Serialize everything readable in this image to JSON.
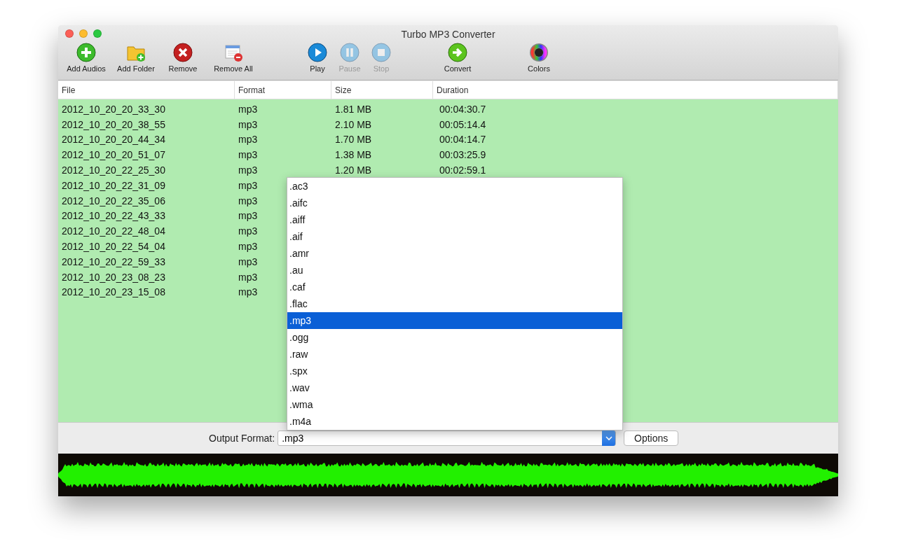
{
  "window": {
    "title": "Turbo MP3 Converter"
  },
  "toolbar": [
    [
      {
        "label": "Add Audios",
        "kind": "add",
        "disabled": false
      },
      {
        "label": "Add Folder",
        "kind": "folder",
        "disabled": false
      },
      {
        "label": "Remove",
        "kind": "remove",
        "disabled": false
      },
      {
        "label": "Remove All",
        "kind": "removeall",
        "disabled": false
      }
    ],
    [
      {
        "label": "Play",
        "kind": "play",
        "disabled": false
      },
      {
        "label": "Pause",
        "kind": "pause",
        "disabled": true
      },
      {
        "label": "Stop",
        "kind": "stop",
        "disabled": true
      }
    ],
    [
      {
        "label": "Convert",
        "kind": "convert",
        "disabled": false
      }
    ],
    [
      {
        "label": "Colors",
        "kind": "colors",
        "disabled": false
      }
    ]
  ],
  "table": {
    "columns": [
      "File",
      "Format",
      "Size",
      "Duration"
    ],
    "rows": [
      {
        "file": "2012_10_20_20_33_30",
        "format": "mp3",
        "size": "1.81 MB",
        "duration": "00:04:30.7"
      },
      {
        "file": "2012_10_20_20_38_55",
        "format": "mp3",
        "size": "2.10 MB",
        "duration": "00:05:14.4"
      },
      {
        "file": "2012_10_20_20_44_34",
        "format": "mp3",
        "size": "1.70 MB",
        "duration": "00:04:14.7"
      },
      {
        "file": "2012_10_20_20_51_07",
        "format": "mp3",
        "size": "1.38 MB",
        "duration": "00:03:25.9"
      },
      {
        "file": "2012_10_20_22_25_30",
        "format": "mp3",
        "size": "1.20 MB",
        "duration": "00:02:59.1"
      },
      {
        "file": "2012_10_20_22_31_09",
        "format": "mp3"
      },
      {
        "file": "2012_10_20_22_35_06",
        "format": "mp3"
      },
      {
        "file": "2012_10_20_22_43_33",
        "format": "mp3"
      },
      {
        "file": "2012_10_20_22_48_04",
        "format": "mp3"
      },
      {
        "file": "2012_10_20_22_54_04",
        "format": "mp3"
      },
      {
        "file": "2012_10_20_22_59_33",
        "format": "mp3"
      },
      {
        "file": "2012_10_20_23_08_23",
        "format": "mp3"
      },
      {
        "file": "2012_10_20_23_15_08",
        "format": "mp3"
      }
    ]
  },
  "output_format": {
    "label": "Output Format:",
    "value": ".mp3",
    "options_button": "Options",
    "dropdown": [
      {
        "label": ".ac3",
        "selected": false
      },
      {
        "label": ".aifc",
        "selected": false
      },
      {
        "label": ".aiff",
        "selected": false
      },
      {
        "label": ".aif",
        "selected": false
      },
      {
        "label": ".amr",
        "selected": false
      },
      {
        "label": ".au",
        "selected": false
      },
      {
        "label": ".caf",
        "selected": false
      },
      {
        "label": ".flac",
        "selected": false
      },
      {
        "label": ".mp3",
        "selected": true
      },
      {
        "label": ".ogg",
        "selected": false
      },
      {
        "label": ".raw",
        "selected": false
      },
      {
        "label": ".spx",
        "selected": false
      },
      {
        "label": ".wav",
        "selected": false
      },
      {
        "label": ".wma",
        "selected": false
      },
      {
        "label": ".m4a",
        "selected": false
      }
    ]
  }
}
